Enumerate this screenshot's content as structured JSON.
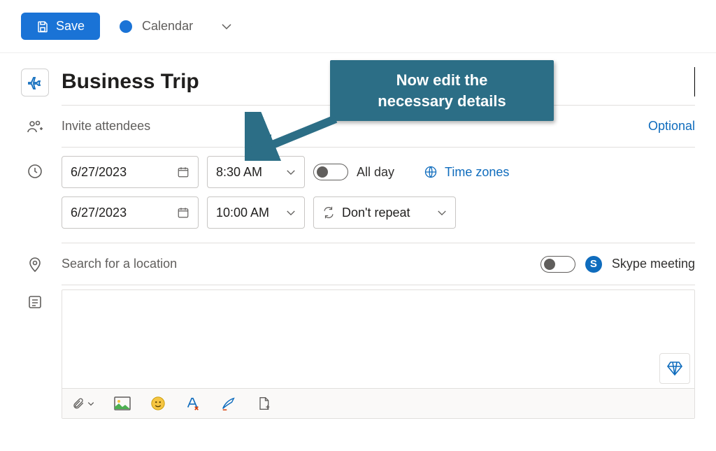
{
  "toolbar": {
    "save_label": "Save",
    "calendar_label": "Calendar"
  },
  "event": {
    "title": "Business Trip",
    "attendees_placeholder": "Invite attendees",
    "optional_label": "Optional",
    "start_date": "6/27/2023",
    "start_time": "8:30 AM",
    "end_date": "6/27/2023",
    "end_time": "10:00 AM",
    "allday_label": "All day",
    "allday_on": false,
    "timezones_label": "Time zones",
    "repeat_label": "Don't repeat",
    "location_placeholder": "Search for a location",
    "skype_label": "Skype meeting",
    "skype_on": false
  },
  "colors": {
    "accent": "#1a73d6",
    "link": "#0f6cbd",
    "callout": "#2c6e86"
  },
  "callout": {
    "line1": "Now edit the",
    "line2": "necessary details"
  }
}
